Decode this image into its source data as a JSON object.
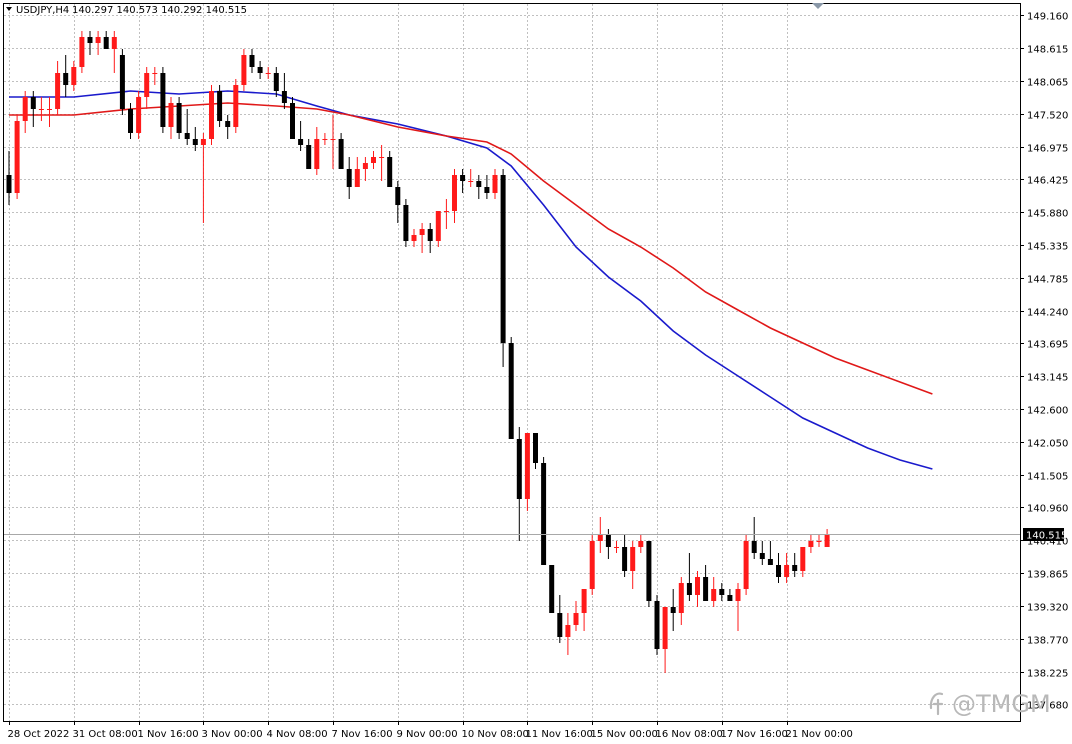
{
  "header": {
    "symbol_label": "USDJPY,H4",
    "ohlc_label": "140.297 140.573 140.292 140.515"
  },
  "watermark": "@TMGM",
  "colors": {
    "bull": "#ff1a1a",
    "bear": "#000000",
    "ma_fast": "#1a1acc",
    "ma_slow": "#e01818",
    "grid": "#c0c0c0",
    "price_line": "#a8a8a8"
  },
  "chart_data": {
    "type": "candlestick",
    "symbol": "USDJPY",
    "timeframe": "H4",
    "last_price": 140.515,
    "last_price_label": "140.515",
    "ylim": [
      137.4,
      149.35
    ],
    "y_ticks": [
      149.16,
      148.615,
      148.065,
      147.52,
      146.975,
      146.425,
      145.88,
      145.335,
      144.785,
      144.24,
      143.695,
      143.145,
      142.6,
      142.05,
      141.505,
      140.96,
      140.41,
      139.865,
      139.32,
      138.77,
      138.225,
      137.68
    ],
    "y_tick_labels": [
      "149.160",
      "148.615",
      "148.065",
      "147.520",
      "146.975",
      "146.425",
      "145.880",
      "145.335",
      "144.785",
      "144.240",
      "143.695",
      "143.145",
      "142.600",
      "142.050",
      "141.505",
      "140.960",
      "140.410",
      "139.865",
      "139.320",
      "138.770",
      "138.225",
      "137.680"
    ],
    "x_tick_labels": [
      "28 Oct 2022",
      "31 Oct 08:00",
      "1 Nov 16:00",
      "3 Nov 00:00",
      "4 Nov 08:00",
      "7 Nov 16:00",
      "9 Nov 00:00",
      "10 Nov 08:00",
      "11 Nov 16:00",
      "15 Nov 00:00",
      "16 Nov 08:00",
      "17 Nov 16:00",
      "21 Nov 00:00"
    ],
    "x_tick_bars": [
      0,
      8,
      16,
      24,
      32,
      40,
      48,
      56,
      64,
      72,
      80,
      88,
      96
    ],
    "ohlc": [
      [
        146.5,
        146.9,
        146.0,
        146.2
      ],
      [
        146.2,
        147.5,
        146.1,
        147.4
      ],
      [
        147.4,
        147.9,
        147.2,
        147.8
      ],
      [
        147.8,
        147.9,
        147.3,
        147.6
      ],
      [
        147.6,
        147.8,
        147.4,
        147.6
      ],
      [
        147.6,
        147.8,
        147.3,
        147.6
      ],
      [
        147.6,
        148.4,
        147.5,
        148.2
      ],
      [
        148.2,
        148.5,
        147.8,
        148.0
      ],
      [
        148.0,
        148.4,
        147.9,
        148.3
      ],
      [
        148.3,
        148.9,
        148.2,
        148.8
      ],
      [
        148.8,
        148.9,
        148.5,
        148.7
      ],
      [
        148.7,
        148.9,
        148.5,
        148.8
      ],
      [
        148.8,
        148.9,
        148.6,
        148.6
      ],
      [
        148.6,
        148.9,
        148.2,
        148.8
      ],
      [
        148.5,
        148.6,
        147.5,
        147.6
      ],
      [
        147.6,
        147.7,
        147.1,
        147.2
      ],
      [
        147.2,
        147.9,
        147.1,
        147.8
      ],
      [
        147.8,
        148.3,
        147.6,
        148.2
      ],
      [
        148.2,
        148.3,
        148.0,
        148.2
      ],
      [
        148.2,
        148.3,
        147.2,
        147.3
      ],
      [
        147.3,
        147.8,
        147.1,
        147.7
      ],
      [
        147.7,
        147.8,
        147.1,
        147.2
      ],
      [
        147.2,
        147.6,
        147.0,
        147.1
      ],
      [
        147.1,
        147.3,
        146.9,
        147.0
      ],
      [
        147.0,
        147.2,
        145.7,
        147.1
      ],
      [
        147.1,
        148.0,
        147.0,
        147.9
      ],
      [
        147.9,
        148.0,
        147.3,
        147.4
      ],
      [
        147.4,
        147.5,
        147.1,
        147.3
      ],
      [
        147.3,
        148.1,
        147.2,
        148.0
      ],
      [
        148.0,
        148.6,
        147.9,
        148.5
      ],
      [
        148.5,
        148.6,
        148.2,
        148.3
      ],
      [
        148.3,
        148.4,
        148.1,
        148.2
      ],
      [
        148.2,
        148.3,
        148.1,
        148.2
      ],
      [
        148.2,
        148.3,
        147.8,
        147.9
      ],
      [
        147.9,
        148.2,
        147.6,
        147.7
      ],
      [
        147.7,
        147.8,
        147.1,
        147.1
      ],
      [
        147.1,
        147.4,
        146.9,
        147.0
      ],
      [
        147.0,
        147.1,
        146.6,
        146.6
      ],
      [
        146.6,
        147.3,
        146.5,
        147.1
      ],
      [
        147.1,
        147.2,
        147.0,
        147.1
      ],
      [
        147.1,
        147.5,
        146.6,
        147.1
      ],
      [
        147.1,
        147.2,
        146.6,
        146.6
      ],
      [
        146.6,
        146.8,
        146.1,
        146.3
      ],
      [
        146.3,
        146.8,
        146.3,
        146.6
      ],
      [
        146.6,
        146.8,
        146.4,
        146.7
      ],
      [
        146.7,
        146.9,
        146.6,
        146.8
      ],
      [
        146.8,
        147.0,
        146.4,
        146.8
      ],
      [
        146.8,
        146.9,
        146.3,
        146.3
      ],
      [
        146.3,
        146.4,
        145.7,
        146.0
      ],
      [
        146.0,
        146.1,
        145.3,
        145.4
      ],
      [
        145.4,
        145.6,
        145.3,
        145.5
      ],
      [
        145.5,
        145.7,
        145.2,
        145.6
      ],
      [
        145.6,
        145.7,
        145.2,
        145.4
      ],
      [
        145.4,
        145.9,
        145.3,
        145.9
      ],
      [
        145.9,
        146.1,
        145.6,
        145.9
      ],
      [
        145.9,
        146.6,
        145.7,
        146.5
      ],
      [
        146.5,
        146.6,
        146.2,
        146.4
      ],
      [
        146.4,
        146.6,
        146.3,
        146.4
      ],
      [
        146.4,
        146.5,
        146.1,
        146.3
      ],
      [
        146.3,
        146.5,
        146.1,
        146.2
      ],
      [
        146.2,
        146.6,
        146.1,
        146.5
      ],
      [
        146.5,
        146.6,
        143.3,
        143.7
      ],
      [
        143.7,
        143.8,
        142.1,
        142.1
      ],
      [
        142.1,
        142.3,
        140.4,
        141.1
      ],
      [
        141.1,
        142.2,
        140.9,
        142.2
      ],
      [
        142.2,
        142.2,
        141.6,
        141.7
      ],
      [
        141.7,
        141.8,
        140.0,
        140.0
      ],
      [
        140.0,
        140.0,
        139.2,
        139.2
      ],
      [
        139.2,
        139.5,
        138.7,
        138.8
      ],
      [
        138.8,
        139.2,
        138.5,
        139.0
      ],
      [
        139.0,
        139.4,
        138.9,
        139.2
      ],
      [
        139.2,
        139.6,
        138.9,
        139.6
      ],
      [
        139.6,
        140.5,
        139.5,
        140.4
      ],
      [
        140.4,
        140.8,
        140.2,
        140.5
      ],
      [
        140.5,
        140.6,
        140.1,
        140.3
      ],
      [
        140.3,
        140.4,
        140.2,
        140.3
      ],
      [
        140.3,
        140.5,
        139.8,
        139.9
      ],
      [
        139.9,
        140.4,
        139.6,
        140.3
      ],
      [
        140.3,
        140.5,
        140.2,
        140.4
      ],
      [
        140.4,
        140.4,
        139.3,
        139.4
      ],
      [
        139.4,
        139.5,
        138.5,
        138.6
      ],
      [
        138.6,
        139.3,
        138.2,
        139.3
      ],
      [
        139.3,
        139.6,
        138.9,
        139.2
      ],
      [
        139.2,
        139.8,
        139.0,
        139.7
      ],
      [
        139.7,
        140.2,
        139.4,
        139.5
      ],
      [
        139.5,
        139.9,
        139.3,
        139.8
      ],
      [
        139.8,
        140.0,
        139.4,
        139.4
      ],
      [
        139.4,
        139.8,
        139.3,
        139.6
      ],
      [
        139.6,
        139.7,
        139.4,
        139.5
      ],
      [
        139.5,
        139.6,
        139.4,
        139.4
      ],
      [
        139.4,
        139.7,
        138.9,
        139.6
      ],
      [
        139.6,
        140.5,
        139.5,
        140.4
      ],
      [
        140.4,
        140.8,
        140.1,
        140.2
      ],
      [
        140.2,
        140.4,
        140.0,
        140.1
      ],
      [
        140.1,
        140.4,
        140.0,
        140.0
      ],
      [
        140.0,
        140.2,
        139.7,
        139.8
      ],
      [
        139.8,
        140.2,
        139.7,
        140.0
      ],
      [
        140.0,
        140.2,
        139.8,
        139.9
      ],
      [
        139.9,
        140.3,
        139.8,
        140.3
      ],
      [
        140.3,
        140.5,
        140.2,
        140.4
      ],
      [
        140.4,
        140.5,
        140.3,
        140.4
      ],
      [
        140.3,
        140.6,
        140.3,
        140.5
      ]
    ],
    "series": [
      {
        "kind": "moving_average",
        "color": "#1a1acc",
        "points": [
          [
            0,
            147.8
          ],
          [
            8,
            147.8
          ],
          [
            15,
            147.9
          ],
          [
            21,
            147.85
          ],
          [
            27,
            147.9
          ],
          [
            33,
            147.85
          ],
          [
            38,
            147.65
          ],
          [
            42,
            147.5
          ],
          [
            48,
            147.35
          ],
          [
            54,
            147.15
          ],
          [
            59,
            146.95
          ],
          [
            62,
            146.65
          ],
          [
            66,
            146.0
          ],
          [
            70,
            145.3
          ],
          [
            74,
            144.8
          ],
          [
            78,
            144.4
          ],
          [
            82,
            143.9
          ],
          [
            86,
            143.5
          ],
          [
            90,
            143.15
          ],
          [
            94,
            142.8
          ],
          [
            98,
            142.45
          ],
          [
            102,
            142.2
          ],
          [
            106,
            141.95
          ],
          [
            110,
            141.75
          ],
          [
            114,
            141.6
          ]
        ]
      },
      {
        "kind": "moving_average",
        "color": "#e01818",
        "points": [
          [
            0,
            147.5
          ],
          [
            8,
            147.5
          ],
          [
            15,
            147.6
          ],
          [
            21,
            147.65
          ],
          [
            27,
            147.7
          ],
          [
            33,
            147.65
          ],
          [
            38,
            147.6
          ],
          [
            42,
            147.5
          ],
          [
            48,
            147.3
          ],
          [
            54,
            147.15
          ],
          [
            59,
            147.05
          ],
          [
            62,
            146.85
          ],
          [
            66,
            146.4
          ],
          [
            70,
            146.0
          ],
          [
            74,
            145.6
          ],
          [
            78,
            145.3
          ],
          [
            82,
            144.95
          ],
          [
            86,
            144.55
          ],
          [
            90,
            144.25
          ],
          [
            94,
            143.95
          ],
          [
            98,
            143.7
          ],
          [
            102,
            143.45
          ],
          [
            106,
            143.25
          ],
          [
            110,
            143.05
          ],
          [
            114,
            142.85
          ]
        ]
      }
    ],
    "grid": true
  }
}
